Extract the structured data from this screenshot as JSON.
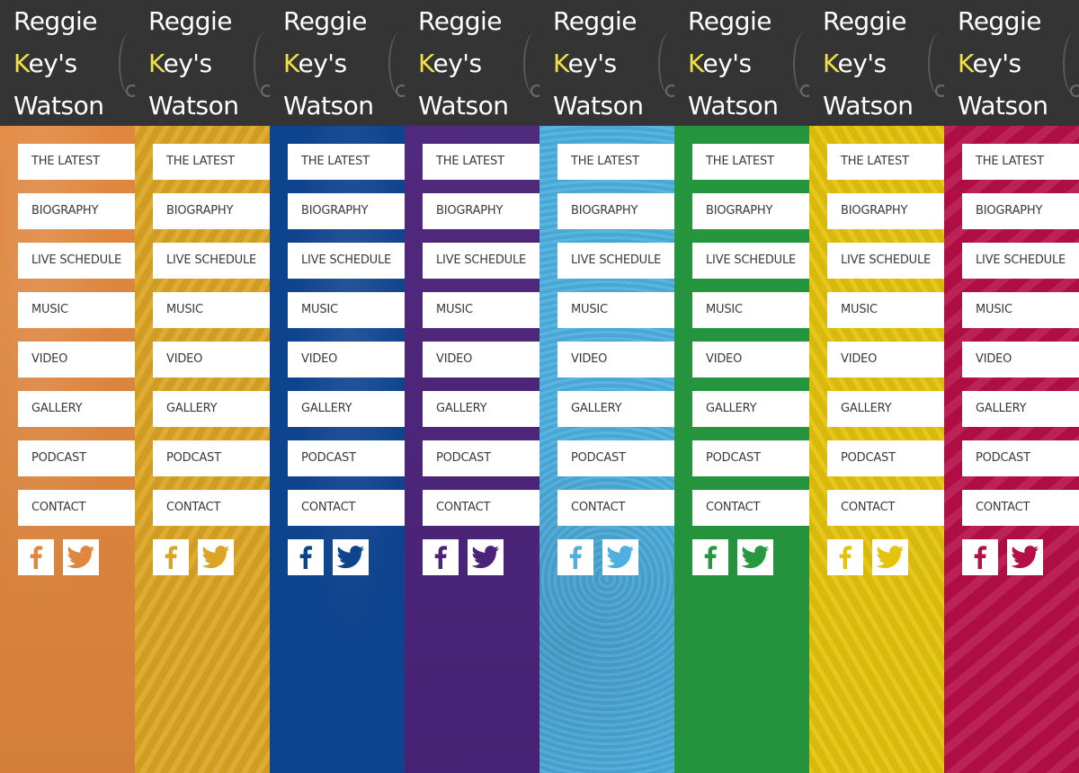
{
  "site": {
    "logo": {
      "line1": "Reggie",
      "line2_k": "K",
      "line2_rest": "ey's",
      "line3": "Watson"
    },
    "logo_k_color": "#f0e34a",
    "header_bg": "#343434"
  },
  "nav": [
    "THE LATEST",
    "BIOGRAPHY",
    "LIVE SCHEDULE",
    "MUSIC",
    "VIDEO",
    "GALLERY",
    "PODCAST",
    "CONTACT"
  ],
  "social": [
    {
      "name": "facebook-icon"
    },
    {
      "name": "twitter-icon"
    }
  ],
  "themes": [
    {
      "name": "orange",
      "color": "#e0873f"
    },
    {
      "name": "gold",
      "color": "#dba424"
    },
    {
      "name": "blue",
      "color": "#0e438d"
    },
    {
      "name": "purple",
      "color": "#4b2379"
    },
    {
      "name": "sky",
      "color": "#4fb0e0"
    },
    {
      "name": "green",
      "color": "#26983f"
    },
    {
      "name": "yellow",
      "color": "#e3c30c"
    },
    {
      "name": "crimson",
      "color": "#b50f47"
    }
  ]
}
